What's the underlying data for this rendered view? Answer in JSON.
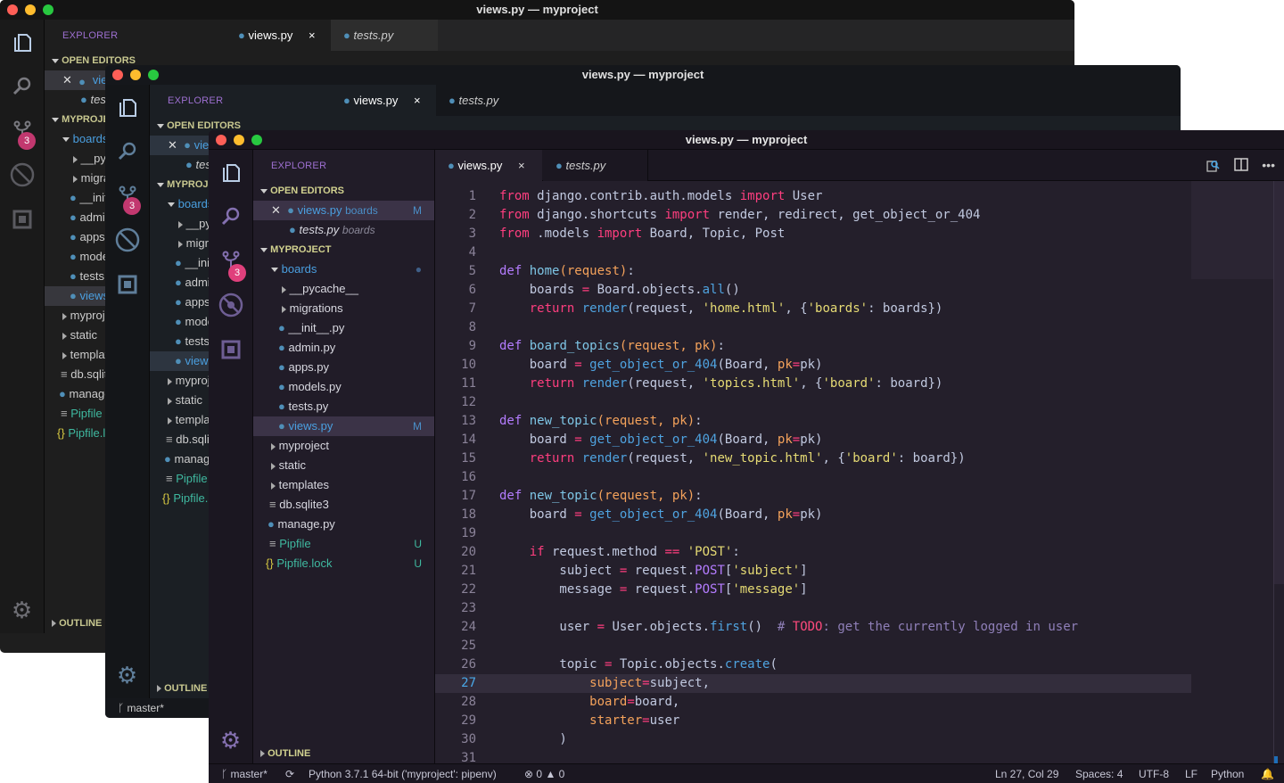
{
  "window_title": "views.py — myproject",
  "explorer_title": "EXPLORER",
  "sections": {
    "open_editors": "OPEN EDITORS",
    "project": "MYPROJECT",
    "outline": "OUTLINE"
  },
  "open_editors": [
    {
      "name": "views.py",
      "folder": "boards",
      "decoration": "M",
      "active": true
    },
    {
      "name": "tests.py",
      "folder": "boards",
      "decoration": "",
      "active": false
    }
  ],
  "tree": [
    {
      "name": "boards",
      "type": "folder-open",
      "level": 1,
      "decoration": "●"
    },
    {
      "name": "__pycache__",
      "type": "folder",
      "level": 2,
      "decoration": ""
    },
    {
      "name": "migrations",
      "type": "folder",
      "level": 2,
      "decoration": ""
    },
    {
      "name": "__init__.py",
      "type": "python",
      "level": 2,
      "decoration": ""
    },
    {
      "name": "admin.py",
      "type": "python",
      "level": 2,
      "decoration": ""
    },
    {
      "name": "apps.py",
      "type": "python",
      "level": 2,
      "decoration": ""
    },
    {
      "name": "models.py",
      "type": "python",
      "level": 2,
      "decoration": ""
    },
    {
      "name": "tests.py",
      "type": "python",
      "level": 2,
      "decoration": ""
    },
    {
      "name": "views.py",
      "type": "python",
      "level": 2,
      "decoration": "M",
      "selected": true
    },
    {
      "name": "myproject",
      "type": "folder",
      "level": 1,
      "decoration": ""
    },
    {
      "name": "static",
      "type": "folder",
      "level": 1,
      "decoration": ""
    },
    {
      "name": "templates",
      "type": "folder",
      "level": 1,
      "decoration": ""
    },
    {
      "name": "db.sqlite3",
      "type": "text",
      "level": 1,
      "decoration": ""
    },
    {
      "name": "manage.py",
      "type": "python",
      "level": 1,
      "decoration": ""
    },
    {
      "name": "Pipfile",
      "type": "text",
      "level": 1,
      "decoration": "U",
      "untracked": true
    },
    {
      "name": "Pipfile.lock",
      "type": "json",
      "level": 1,
      "decoration": "U",
      "untracked": true
    }
  ],
  "tabs": [
    {
      "label": "views.py",
      "active": true,
      "close": "×"
    },
    {
      "label": "tests.py",
      "active": false
    }
  ],
  "scm_badge": "3",
  "code_lines": [
    [
      [
        "k",
        "from"
      ],
      [
        "b",
        " django.contrib.auth.models "
      ],
      [
        "k",
        "import"
      ],
      [
        "b",
        " User"
      ]
    ],
    [
      [
        "k",
        "from"
      ],
      [
        "b",
        " django.shortcuts "
      ],
      [
        "k",
        "import"
      ],
      [
        "b",
        " render, redirect, get_object_or_404"
      ]
    ],
    [
      [
        "k",
        "from"
      ],
      [
        "b",
        " .models "
      ],
      [
        "k",
        "import"
      ],
      [
        "b",
        " Board, Topic, Post"
      ]
    ],
    [],
    [
      [
        "pur",
        "def"
      ],
      [
        "b",
        " "
      ],
      [
        "fn",
        "home"
      ],
      [
        "p",
        "(request)"
      ],
      [
        "b",
        ":"
      ]
    ],
    [
      [
        "b",
        "    boards "
      ],
      [
        "op",
        "="
      ],
      [
        "b",
        " Board.objects."
      ],
      [
        "m",
        "all"
      ],
      [
        "b",
        "()"
      ]
    ],
    [
      [
        "b",
        "    "
      ],
      [
        "k",
        "return"
      ],
      [
        "b",
        " "
      ],
      [
        "m",
        "render"
      ],
      [
        "b",
        "(request, "
      ],
      [
        "s",
        "'home.html'"
      ],
      [
        "b",
        ", {"
      ],
      [
        "s",
        "'boards'"
      ],
      [
        "b",
        ": boards})"
      ]
    ],
    [],
    [
      [
        "pur",
        "def"
      ],
      [
        "b",
        " "
      ],
      [
        "fn",
        "board_topics"
      ],
      [
        "p",
        "(request, pk)"
      ],
      [
        "b",
        ":"
      ]
    ],
    [
      [
        "b",
        "    board "
      ],
      [
        "op",
        "="
      ],
      [
        "b",
        " "
      ],
      [
        "m",
        "get_object_or_404"
      ],
      [
        "b",
        "(Board, "
      ],
      [
        "p",
        "pk"
      ],
      [
        "op",
        "="
      ],
      [
        "b",
        "pk)"
      ]
    ],
    [
      [
        "b",
        "    "
      ],
      [
        "k",
        "return"
      ],
      [
        "b",
        " "
      ],
      [
        "m",
        "render"
      ],
      [
        "b",
        "(request, "
      ],
      [
        "s",
        "'topics.html'"
      ],
      [
        "b",
        ", {"
      ],
      [
        "s",
        "'board'"
      ],
      [
        "b",
        ": board})"
      ]
    ],
    [],
    [
      [
        "pur",
        "def"
      ],
      [
        "b",
        " "
      ],
      [
        "fn",
        "new_topic"
      ],
      [
        "p",
        "(request, pk)"
      ],
      [
        "b",
        ":"
      ]
    ],
    [
      [
        "b",
        "    board "
      ],
      [
        "op",
        "="
      ],
      [
        "b",
        " "
      ],
      [
        "m",
        "get_object_or_404"
      ],
      [
        "b",
        "(Board, "
      ],
      [
        "p",
        "pk"
      ],
      [
        "op",
        "="
      ],
      [
        "b",
        "pk)"
      ]
    ],
    [
      [
        "b",
        "    "
      ],
      [
        "k",
        "return"
      ],
      [
        "b",
        " "
      ],
      [
        "m",
        "render"
      ],
      [
        "b",
        "(request, "
      ],
      [
        "s",
        "'new_topic.html'"
      ],
      [
        "b",
        ", {"
      ],
      [
        "s",
        "'board'"
      ],
      [
        "b",
        ": board})"
      ]
    ],
    [],
    [
      [
        "pur",
        "def"
      ],
      [
        "b",
        " "
      ],
      [
        "fn",
        "new_topic"
      ],
      [
        "p",
        "(request, pk)"
      ],
      [
        "b",
        ":"
      ]
    ],
    [
      [
        "b",
        "    board "
      ],
      [
        "op",
        "="
      ],
      [
        "b",
        " "
      ],
      [
        "m",
        "get_object_or_404"
      ],
      [
        "b",
        "(Board, "
      ],
      [
        "p",
        "pk"
      ],
      [
        "op",
        "="
      ],
      [
        "b",
        "pk)"
      ]
    ],
    [],
    [
      [
        "b",
        "    "
      ],
      [
        "k",
        "if"
      ],
      [
        "b",
        " request.method "
      ],
      [
        "op",
        "=="
      ],
      [
        "b",
        " "
      ],
      [
        "s",
        "'POST'"
      ],
      [
        "b",
        ":"
      ]
    ],
    [
      [
        "b",
        "        subject "
      ],
      [
        "op",
        "="
      ],
      [
        "b",
        " request."
      ],
      [
        "pur",
        "POST"
      ],
      [
        "b",
        "["
      ],
      [
        "s",
        "'subject'"
      ],
      [
        "b",
        "]"
      ]
    ],
    [
      [
        "b",
        "        message "
      ],
      [
        "op",
        "="
      ],
      [
        "b",
        " request."
      ],
      [
        "pur",
        "POST"
      ],
      [
        "b",
        "["
      ],
      [
        "s",
        "'message'"
      ],
      [
        "b",
        "]"
      ]
    ],
    [],
    [
      [
        "b",
        "        user "
      ],
      [
        "op",
        "="
      ],
      [
        "b",
        " User.objects."
      ],
      [
        "m",
        "first"
      ],
      [
        "b",
        "()  "
      ],
      [
        "c",
        "# "
      ],
      [
        "t",
        "TODO"
      ],
      [
        "c",
        ": get the currently logged in user"
      ]
    ],
    [],
    [
      [
        "b",
        "        topic "
      ],
      [
        "op",
        "="
      ],
      [
        "b",
        " Topic.objects."
      ],
      [
        "m",
        "create"
      ],
      [
        "b",
        "("
      ]
    ],
    [
      [
        "b",
        "            "
      ],
      [
        "p",
        "subject"
      ],
      [
        "op",
        "="
      ],
      [
        "b",
        "subject,"
      ]
    ],
    [
      [
        "b",
        "            "
      ],
      [
        "p",
        "board"
      ],
      [
        "op",
        "="
      ],
      [
        "b",
        "board,"
      ]
    ],
    [
      [
        "b",
        "            "
      ],
      [
        "p",
        "starter"
      ],
      [
        "op",
        "="
      ],
      [
        "b",
        "user"
      ]
    ],
    [
      [
        "b",
        "        )"
      ]
    ],
    []
  ],
  "current_line": 27,
  "status": {
    "branch": "master*",
    "interpreter": "Python 3.7.1 64-bit ('myproject': pipenv)",
    "errors": "0",
    "warnings": "0",
    "position": "Ln 27, Col 29",
    "indent": "Spaces: 4",
    "encoding": "UTF-8",
    "eol": "LF",
    "language": "Python"
  },
  "colors": {
    "accent_purple": "#8c6cc4",
    "section_header": "#d1d18f",
    "selected_row": "#3b3347",
    "python_icon": "#4f8fb8",
    "untracked": "#3fb9a0",
    "badge": "#e0407c"
  }
}
